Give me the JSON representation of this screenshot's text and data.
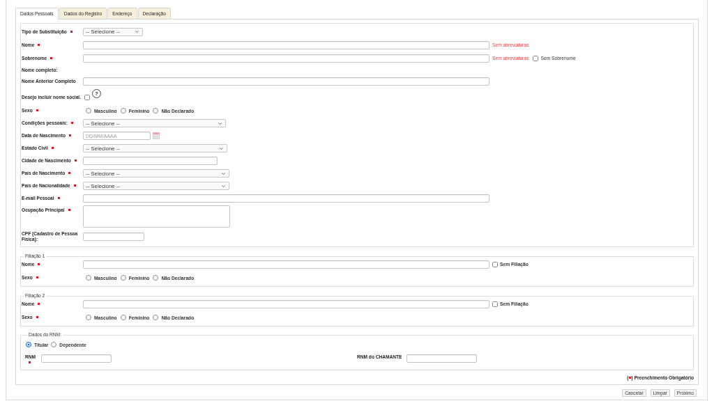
{
  "tabs": [
    {
      "label": "Dados Pessoais",
      "selected": true
    },
    {
      "label": "Dados do Registro",
      "selected": false
    },
    {
      "label": "Endereço",
      "selected": false
    },
    {
      "label": "Declaração",
      "selected": false
    }
  ],
  "personal_fields": [
    {
      "kind": "select",
      "label": "Tipo de Substituição",
      "required": true,
      "value": "-- Selecione --"
    },
    {
      "kind": "text",
      "label": "Nome",
      "required": true,
      "hint": "Sem abreviaturas"
    },
    {
      "kind": "text",
      "label": "Sobrenome",
      "required": true,
      "hint": "Sem abreviaturas",
      "checkbox": {
        "label": "Sem Sobrenome",
        "checked": false
      }
    },
    {
      "kind": "static",
      "label": "Nome completo:",
      "required": false
    },
    {
      "kind": "text",
      "label": "Nome Anterior Completo",
      "required": false
    },
    {
      "kind": "checkbox",
      "label": "Desejo incluir nome social.",
      "required": false,
      "checked": false,
      "help": "?"
    },
    {
      "kind": "radio",
      "label": "Sexo",
      "required": true,
      "options": [
        {
          "label": "Masculino",
          "selected": false
        },
        {
          "label": "Feminino",
          "selected": false
        },
        {
          "label": "Não Declarado",
          "selected": false
        }
      ]
    },
    {
      "kind": "select",
      "label": "Condições pessoais:",
      "required": true,
      "value": "-- Selecione --"
    },
    {
      "kind": "date",
      "label": "Data de Nascimento",
      "required": true,
      "placeholder": "DD/MM/AAAA"
    },
    {
      "kind": "select",
      "label": "Estado Civil",
      "required": true,
      "value": "-- Selecione --"
    },
    {
      "kind": "text",
      "label": "Cidade de Nascimento",
      "required": true
    },
    {
      "kind": "select",
      "label": "País de Nascimento",
      "required": true,
      "value": "-- Selecione --"
    },
    {
      "kind": "select",
      "label": "País de Nacionalidade",
      "required": true,
      "value": "-- Selecione --"
    },
    {
      "kind": "text",
      "label": "E-mail Pessoal",
      "required": true
    },
    {
      "kind": "textarea",
      "label": "Ocupação Principal",
      "required": true
    },
    {
      "kind": "text",
      "label": "CPF (Cadastro de Pessoa Física):",
      "required": false
    }
  ],
  "filiations": [
    {
      "legend": "Filiação 1",
      "fields": [
        {
          "kind": "text",
          "label": "Nome",
          "required": true,
          "checkbox": {
            "label": "Sem Filiação",
            "checked": false
          }
        },
        {
          "kind": "radio",
          "label": "Sexo",
          "required": true,
          "options": [
            {
              "label": "Masculino",
              "selected": false
            },
            {
              "label": "Feminino",
              "selected": false
            },
            {
              "label": "Não Declarado",
              "selected": false
            }
          ]
        }
      ]
    },
    {
      "legend": "Filiação 2",
      "fields": [
        {
          "kind": "text",
          "label": "Nome",
          "required": true,
          "checkbox": {
            "label": "Sem Filiação",
            "checked": false
          }
        },
        {
          "kind": "radio",
          "label": "Sexo",
          "required": true,
          "options": [
            {
              "label": "Masculino",
              "selected": false
            },
            {
              "label": "Feminino",
              "selected": false
            },
            {
              "label": "Não Declarado",
              "selected": false
            }
          ]
        }
      ]
    }
  ],
  "rnm": {
    "legend": "Dados do RNM:",
    "options": [
      {
        "label": "Titular",
        "selected": true
      },
      {
        "label": "Dependente",
        "selected": false
      }
    ],
    "fields": [
      {
        "label": "RNM",
        "required": true
      },
      {
        "label": "RNM do CHAMANTE",
        "required": false
      }
    ]
  },
  "required_note": {
    "open": "(",
    "close": ")",
    "text": "Preenchimento Obrigatório"
  },
  "buttons": [
    {
      "label": "Cancelar"
    },
    {
      "label": "Limpar"
    },
    {
      "label": "Próximo"
    }
  ]
}
